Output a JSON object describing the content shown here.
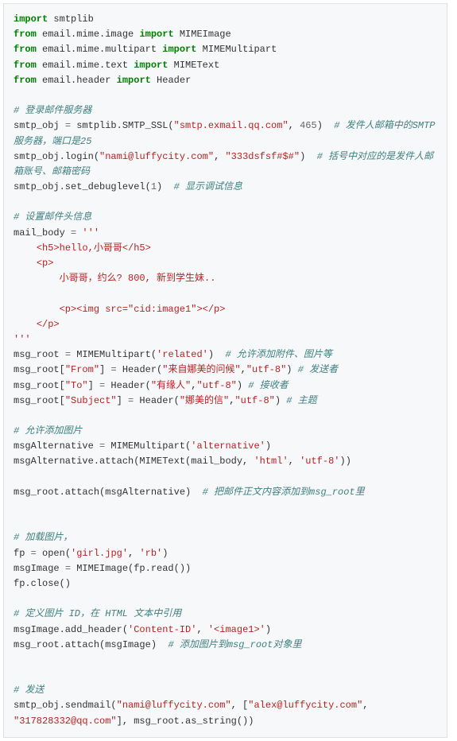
{
  "code": {
    "l1": {
      "a": "import",
      "b": " smtplib"
    },
    "l2": {
      "a": "from",
      "b": " email.mime.image ",
      "c": "import",
      "d": " MIMEImage"
    },
    "l3": {
      "a": "from",
      "b": " email.mime.multipart ",
      "c": "import",
      "d": " MIMEMultipart"
    },
    "l4": {
      "a": "from",
      "b": " email.mime.text ",
      "c": "import",
      "d": " MIMEText"
    },
    "l5": {
      "a": "from",
      "b": " email.header ",
      "c": "import",
      "d": " Header"
    },
    "l7c": "# 登录邮件服务器",
    "l8": {
      "a": "smtp_obj ",
      "b": "=",
      "c": " smtplib.SMTP_SSL(",
      "d": "\"smtp.exmail.qq.com\"",
      "e": ", ",
      "f": "465",
      "g": ")  ",
      "h": "# 发件人邮箱中的SMTP服务器，端口是25"
    },
    "l9": {
      "a": "smtp_obj.login(",
      "b": "\"nami@luffycity.com\"",
      "c": ", ",
      "d": "\"333dsfsf#$#\"",
      "e": ")  ",
      "f": "# 括号中对应的是发件人邮箱账号、邮箱密码"
    },
    "l10": {
      "a": "smtp_obj.set_debuglevel(",
      "b": "1",
      "c": ")  ",
      "d": "# 显示调试信息"
    },
    "l12c": "# 设置邮件头信息",
    "l13": {
      "a": "mail_body ",
      "b": "=",
      "c": " ",
      "d": "'''"
    },
    "l14": "    <h5>hello,小哥哥</h5>",
    "l15": "    <p>",
    "l16": "        小哥哥，约么? 800, 新到学生妹..",
    "l17": "",
    "l18": "        <p><img src=\"cid:image1\"></p>",
    "l19": "    </p>",
    "l20": "'''",
    "l21": {
      "a": "msg_root ",
      "b": "=",
      "c": " MIMEMultipart(",
      "d": "'related'",
      "e": ")  ",
      "f": "# 允许添加附件、图片等"
    },
    "l22": {
      "a": "msg_root[",
      "b": "\"From\"",
      "c": "] ",
      "d": "=",
      "e": " Header(",
      "f": "\"来自娜美的问候\"",
      "g": ",",
      "h": "\"utf-8\"",
      "i": ") ",
      "j": "# 发送者"
    },
    "l23": {
      "a": "msg_root[",
      "b": "\"To\"",
      "c": "] ",
      "d": "=",
      "e": " Header(",
      "f": "\"有缘人\"",
      "g": ",",
      "h": "\"utf-8\"",
      "i": ") ",
      "j": "# 接收者"
    },
    "l24": {
      "a": "msg_root[",
      "b": "\"Subject\"",
      "c": "] ",
      "d": "=",
      "e": " Header(",
      "f": "\"娜美的信\"",
      "g": ",",
      "h": "\"utf-8\"",
      "i": ") ",
      "j": "# 主题"
    },
    "l26c": "# 允许添加图片",
    "l27": {
      "a": "msgAlternative ",
      "b": "=",
      "c": " MIMEMultipart(",
      "d": "'alternative'",
      "e": ")"
    },
    "l28": {
      "a": "msgAlternative.attach(MIMEText(mail_body, ",
      "b": "'html'",
      "c": ", ",
      "d": "'utf-8'",
      "e": "))"
    },
    "l30": {
      "a": "msg_root.attach(msgAlternative)  ",
      "b": "# 把邮件正文内容添加到msg_root里"
    },
    "l33c": "# 加载图片，",
    "l34": {
      "a": "fp ",
      "b": "=",
      "c": " open(",
      "d": "'girl.jpg'",
      "e": ", ",
      "f": "'rb'",
      "g": ")"
    },
    "l35": {
      "a": "msgImage ",
      "b": "=",
      "c": " MIMEImage(fp.read())"
    },
    "l36": "fp.close()",
    "l38c": "# 定义图片 ID，在 HTML 文本中引用",
    "l39": {
      "a": "msgImage.add_header(",
      "b": "'Content-ID'",
      "c": ", ",
      "d": "'<image1>'",
      "e": ")"
    },
    "l40": {
      "a": "msg_root.attach(msgImage)  ",
      "b": "# 添加图片到msg_root对象里"
    },
    "l43c": "# 发送",
    "l44": {
      "a": "smtp_obj.sendmail(",
      "b": "\"nami@luffycity.com\"",
      "c": ", [",
      "d": "\"alex@luffycity.com\"",
      "e": ", ",
      "f": "\"317828332@qq.com\"",
      "g": "], msg_root.as_string())"
    }
  }
}
